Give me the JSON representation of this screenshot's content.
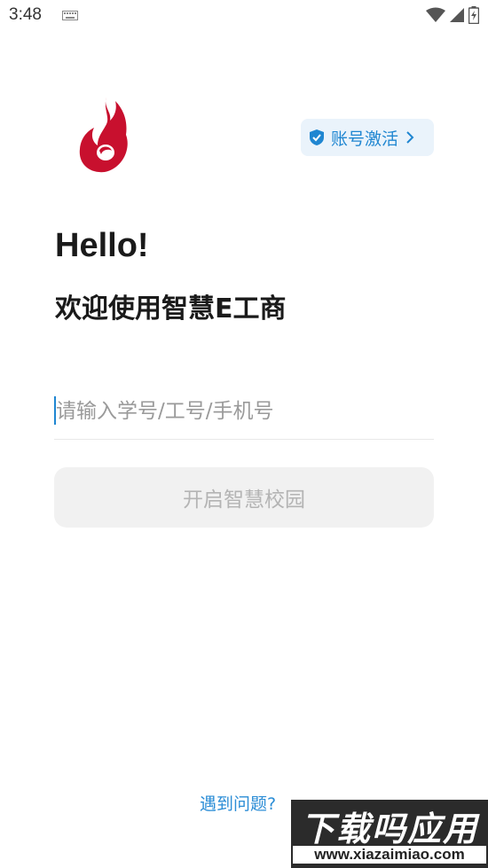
{
  "status_bar": {
    "time": "3:48"
  },
  "header": {
    "activate_label": "账号激活"
  },
  "greeting": {
    "hello": "Hello!",
    "welcome": "欢迎使用智慧E工商"
  },
  "form": {
    "id_placeholder": "请输入学号/工号/手机号",
    "id_value": "",
    "submit_label": "开启智慧校园"
  },
  "footer": {
    "help_label": "遇到问题?"
  },
  "watermark": {
    "main": "下载吗应用",
    "url": "www.xiazaimiao.com"
  },
  "colors": {
    "accent": "#1f86d1",
    "logo_red": "#c8102e",
    "activate_bg": "#eaf3fb",
    "button_disabled_bg": "#f1f1f1"
  },
  "icons": {
    "keyboard": "keyboard-icon",
    "wifi": "wifi-icon",
    "signal": "signal-icon",
    "battery": "battery-charging-icon",
    "shield": "verified-shield-icon",
    "chevron": "chevron-right-icon",
    "logo": "flame-logo-icon"
  }
}
